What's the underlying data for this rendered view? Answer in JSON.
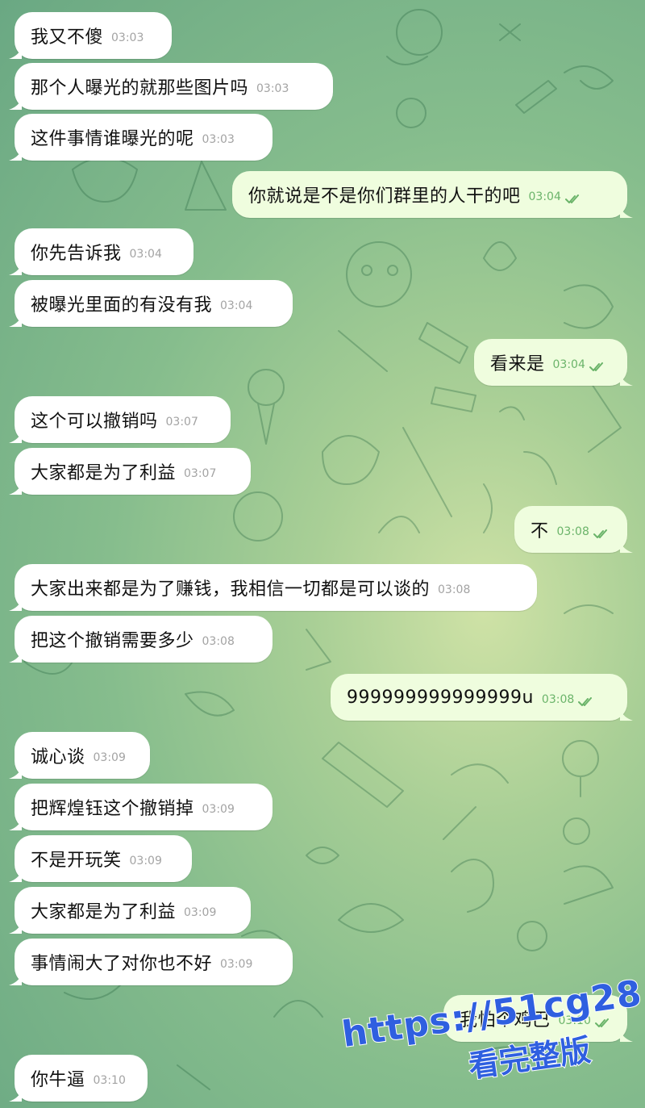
{
  "colors": {
    "incoming_bubble": "#ffffff",
    "outgoing_bubble": "#effdde",
    "outgoing_time": "#6bb46a",
    "incoming_time": "#a3a3a3",
    "watermark": "#2f5fe0"
  },
  "messages": [
    {
      "dir": "in",
      "text": "我又不傻",
      "time": "03:03"
    },
    {
      "dir": "in",
      "text": "那个人曝光的就那些图片吗",
      "time": "03:03"
    },
    {
      "dir": "in",
      "text": "这件事情谁曝光的呢",
      "time": "03:03"
    },
    {
      "dir": "out",
      "text": "你就说是不是你们群里的人干的吧",
      "time": "03:04",
      "read_icon": "double-check-icon"
    },
    {
      "dir": "in",
      "text": "你先告诉我",
      "time": "03:04"
    },
    {
      "dir": "in",
      "text": "被曝光里面的有没有我",
      "time": "03:04"
    },
    {
      "dir": "out",
      "text": "看来是",
      "time": "03:04",
      "read_icon": "double-check-icon"
    },
    {
      "dir": "in",
      "text": "这个可以撤销吗",
      "time": "03:07"
    },
    {
      "dir": "in",
      "text": "大家都是为了利益",
      "time": "03:07"
    },
    {
      "dir": "out",
      "text": "不",
      "time": "03:08",
      "read_icon": "double-check-icon"
    },
    {
      "dir": "in",
      "text": "大家出来都是为了赚钱，我相信一切都是可以谈的",
      "time": "03:08"
    },
    {
      "dir": "in",
      "text": "把这个撤销需要多少",
      "time": "03:08"
    },
    {
      "dir": "out",
      "text": "999999999999999u",
      "time": "03:08",
      "read_icon": "double-check-icon"
    },
    {
      "dir": "in",
      "text": "诚心谈",
      "time": "03:09"
    },
    {
      "dir": "in",
      "text": "把辉煌钰这个撤销掉",
      "time": "03:09"
    },
    {
      "dir": "in",
      "text": "不是开玩笑",
      "time": "03:09"
    },
    {
      "dir": "in",
      "text": "大家都是为了利益",
      "time": "03:09"
    },
    {
      "dir": "in",
      "text": "事情闹大了对你也不好",
      "time": "03:09"
    },
    {
      "dir": "out",
      "text": "我怕个鸡巴",
      "time": "03:10",
      "read_icon": "double-check-icon"
    },
    {
      "dir": "in",
      "text": "你牛逼",
      "time": "03:10"
    }
  ],
  "watermark": {
    "line1": "https://51cg28.com",
    "line2": "看完整版"
  }
}
